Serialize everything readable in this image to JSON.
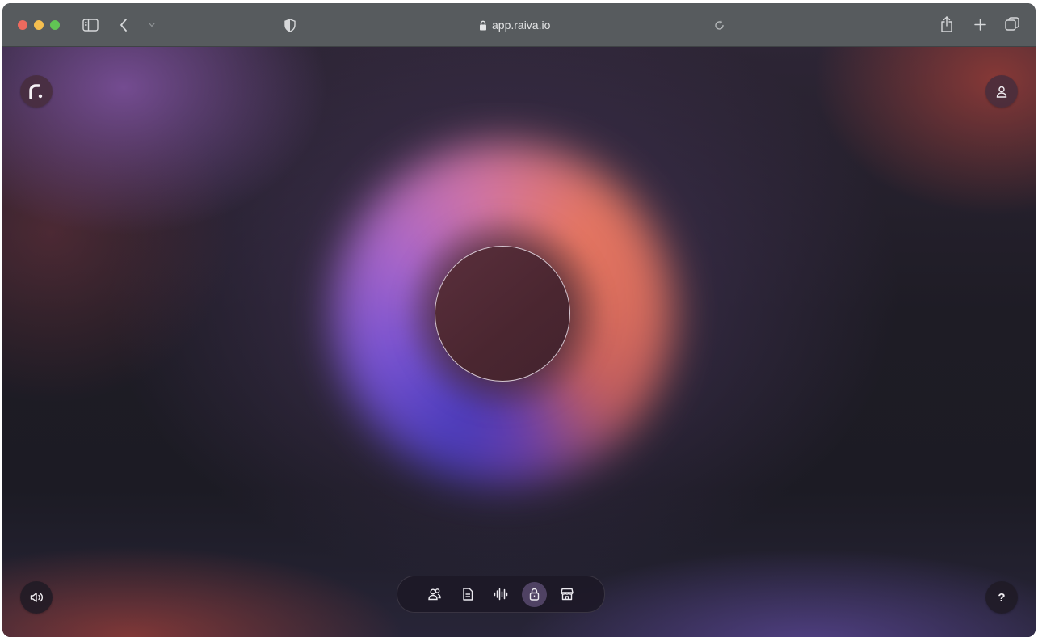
{
  "browser": {
    "url": "app.raiva.io",
    "icons": {
      "sidebar": "sidebar-icon",
      "back": "chevron-left-icon",
      "forward": "chevron-down-icon",
      "privacy": "shield-icon",
      "lock": "lock-icon",
      "reload": "reload-icon",
      "share": "share-icon",
      "new_tab": "plus-icon",
      "tabs": "tabs-overview-icon"
    }
  },
  "app": {
    "logo_icon": "raiva-logo-icon",
    "account_icon": "user-icon",
    "sound_icon": "speaker-icon",
    "help_label": "?",
    "dock": {
      "items": [
        {
          "name": "contacts",
          "icon": "people-icon",
          "active": false
        },
        {
          "name": "documents",
          "icon": "document-icon",
          "active": false
        },
        {
          "name": "voice",
          "icon": "waveform-icon",
          "active": false
        },
        {
          "name": "vault",
          "icon": "lock-icon",
          "active": true
        },
        {
          "name": "store",
          "icon": "storefront-icon",
          "active": false
        }
      ]
    },
    "colors": {
      "orb_blue": "#4a3cc0",
      "orb_purple": "#b06ad0",
      "orb_coral": "#ee7a63",
      "core_fill": "#4a2630"
    }
  }
}
